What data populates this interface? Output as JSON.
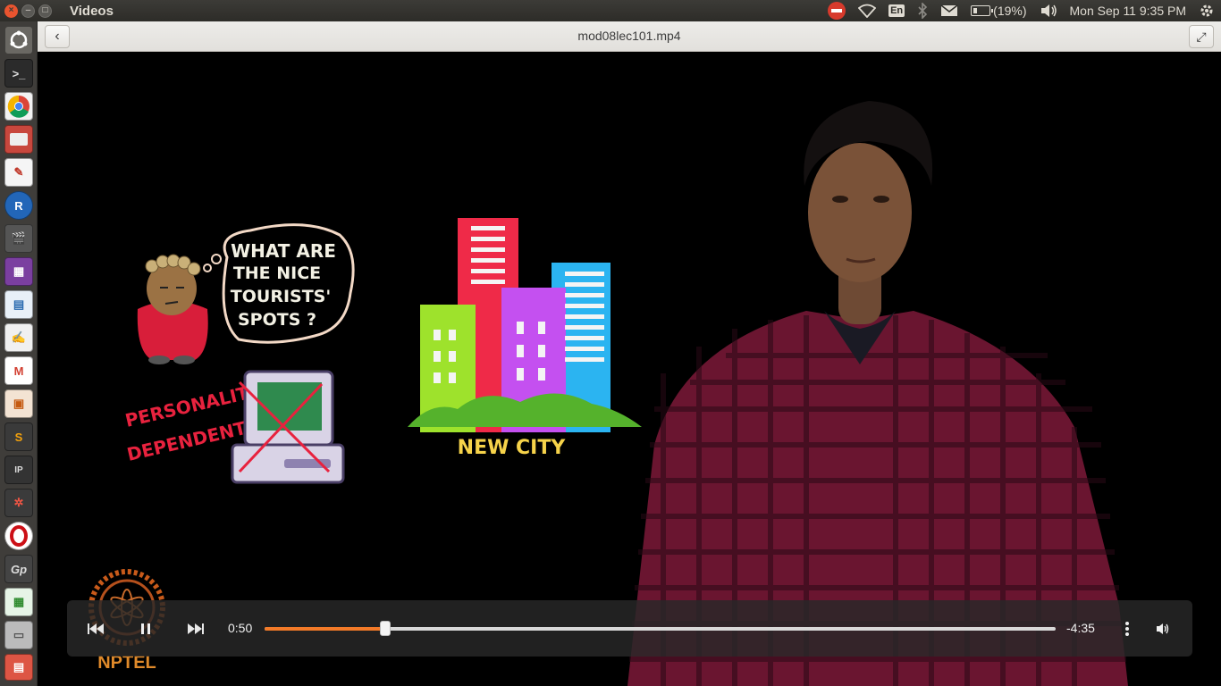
{
  "topbar": {
    "app_title": "Videos",
    "lang": "En",
    "battery": "(19%)",
    "datetime": "Mon Sep 11  9:35 PM"
  },
  "window": {
    "file_title": "mod08lec101.mp4"
  },
  "video": {
    "bubble_lines": [
      "WHAT ARE",
      "THE NICE",
      "TOURISTS'",
      "SPOTS ?"
    ],
    "personality_lines": [
      "PERSONALITY",
      "DEPENDENT"
    ],
    "city_caption": "NEW CITY",
    "logo_text": "NPTEL"
  },
  "player": {
    "elapsed": "0:50",
    "remaining": "-4:35",
    "progress": 0.153
  },
  "launcher": {
    "items": [
      "dash",
      "terminal",
      "chrome",
      "files",
      "pdf-viewer",
      "r",
      "video",
      "media",
      "docs",
      "text-editor",
      "gmail",
      "presentation",
      "sublime",
      "ipython",
      "settings",
      "opera",
      "geogebra",
      "spreadsheet",
      "drive",
      "app"
    ]
  }
}
